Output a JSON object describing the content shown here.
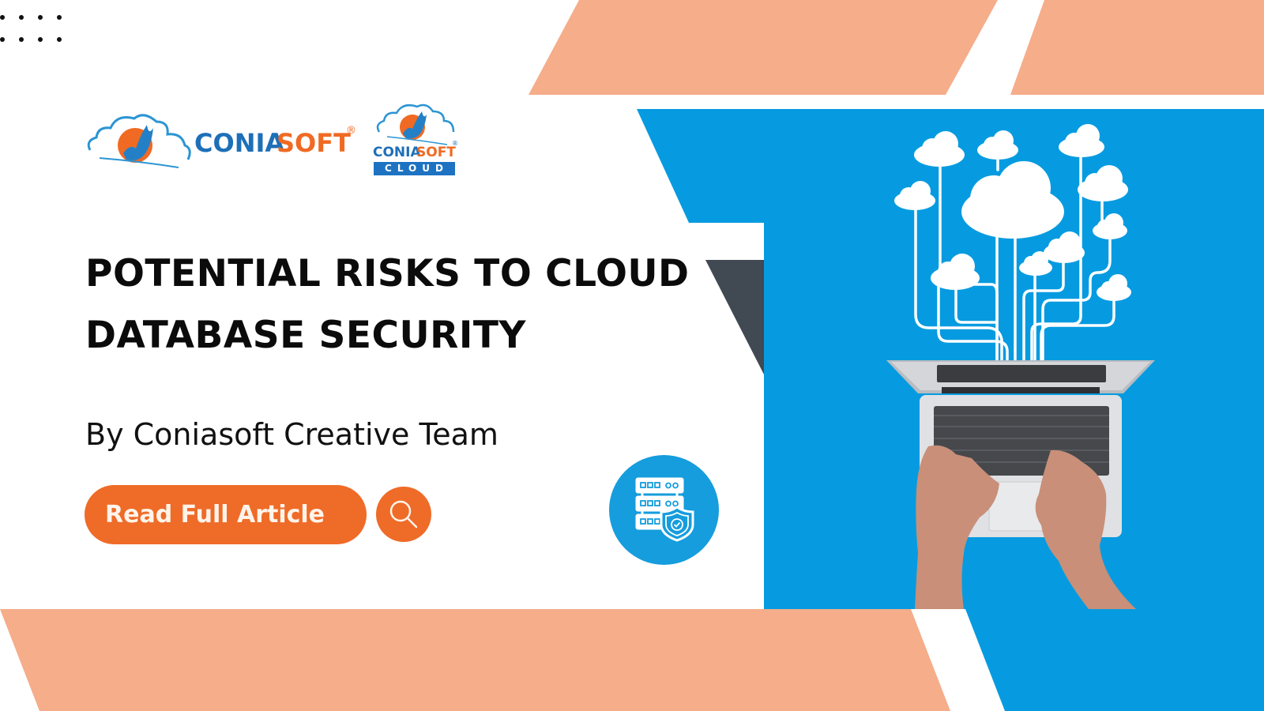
{
  "colors": {
    "peach": "#f5ad8a",
    "blue": "#069be0",
    "dark_slate": "#414953",
    "orange": "#ef6b28",
    "logo_blue": "#1d6fb8",
    "logo_orange": "#f06a23",
    "title_text": "#0b0b0b"
  },
  "logos": {
    "primary": {
      "name_part1": "CONIA",
      "name_part2": "SOFT",
      "registered": "®"
    },
    "cloud": {
      "name_part1": "CONIA",
      "name_part2": "SOFT",
      "registered": "®",
      "badge": "CLOUD"
    }
  },
  "headline": {
    "line1": "POTENTIAL RISKS TO CLOUD",
    "line2": "DATABASE SECURITY"
  },
  "byline": "By Coniasoft Creative Team",
  "cta": {
    "label": "Read Full Article",
    "search_icon": "search-icon"
  },
  "badge_icon": "server-shield-icon",
  "hero_image": {
    "description": "Hands typing on a laptop with cloud network icons above",
    "clouds": 12
  }
}
